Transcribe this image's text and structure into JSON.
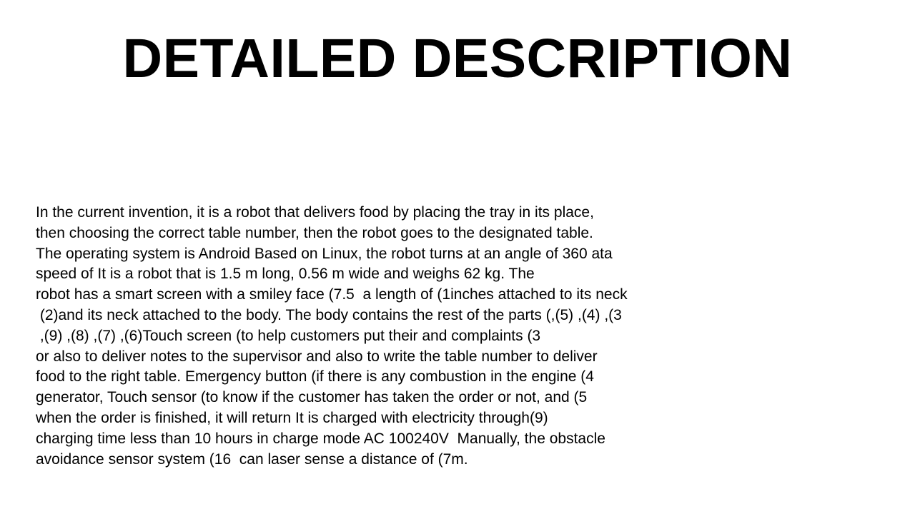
{
  "slide": {
    "title": "DETAILED DESCRIPTION",
    "lines": [
      "In the current invention, it is a robot that delivers food by placing the tray in its place,",
      "then choosing the correct table number, then the robot goes to the designated table.",
      "The operating system is Android Based on Linux, the robot turns at an angle of 360 ata",
      "speed of It is a robot that is 1.5 m long, 0.56 m wide and weighs 62 kg. The",
      "robot has a smart screen with a smiley face (7.5  a length of (1inches attached to its neck",
      " (2)and its neck attached to the body. The body contains the rest of the parts (,(5) ,(4) ,(3",
      " ,(9) ,(8) ,(7) ,(6)Touch screen (to help customers put their and complaints (3",
      "or also to deliver notes to the supervisor and also to write the table number to deliver",
      "food to the right table. Emergency button (if there is any combustion in the engine (4",
      "generator, Touch sensor (to know if the customer has taken the order or not, and (5",
      "when the order is finished, it will return It is charged with electricity through(9)",
      "charging time less than 10 hours in charge mode AC 100240V  Manually, the obstacle",
      "avoidance sensor system (16  can laser sense a distance of (7m."
    ]
  }
}
